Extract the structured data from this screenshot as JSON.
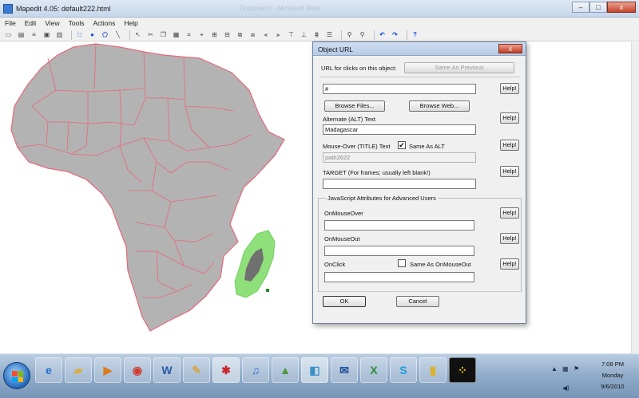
{
  "window": {
    "title": "Mapedit 4.05: default222.html",
    "ghost_title": "Document1 - Microsoft Word",
    "minimize": "–",
    "maximize": "□",
    "close": "x"
  },
  "menu": [
    "File",
    "Edit",
    "View",
    "Tools",
    "Actions",
    "Help"
  ],
  "dialog": {
    "title": "Object URL",
    "close": "x",
    "url_label": "URL for clicks on this object:",
    "same_as_previous": "Same As Previous",
    "url_value": "#",
    "help": "Help!",
    "browse_files": "Browse Files...",
    "browse_web": "Browse Web...",
    "alt_label": "Alternate (ALT) Text",
    "alt_value": "Madagascar",
    "title_label": "Mouse-Over (TITLE) Text",
    "same_as_alt": "Same As ALT",
    "title_value": "path2622",
    "target_label": "TARGET (For frames; usually left blank!)",
    "target_value": "",
    "js_group": "JavaScript Attributes for Advanced Users",
    "onmouseover_label": "OnMouseOver",
    "onmouseout_label": "OnMouseOut",
    "onclick_label": "OnClick",
    "same_as_onmouseout": "Same As OnMouseOut",
    "ok": "OK",
    "cancel": "Cancel",
    "same_as_alt_checked": true
  },
  "map": {
    "continent_fill": "#b3b3b3",
    "border_color": "#e8677a",
    "selected_fill": "#8fe07a"
  },
  "taskbar": {
    "apps": [
      "internet-explorer",
      "windows-explorer",
      "media-player",
      "chrome",
      "word",
      "notepad",
      "paint",
      "itunes",
      "photo-viewer",
      "mapedit",
      "outlook",
      "excel",
      "skype",
      "flashlight",
      "game"
    ]
  },
  "clock": {
    "time": "7:09 PM",
    "day": "Monday",
    "date": "9/6/2010"
  }
}
